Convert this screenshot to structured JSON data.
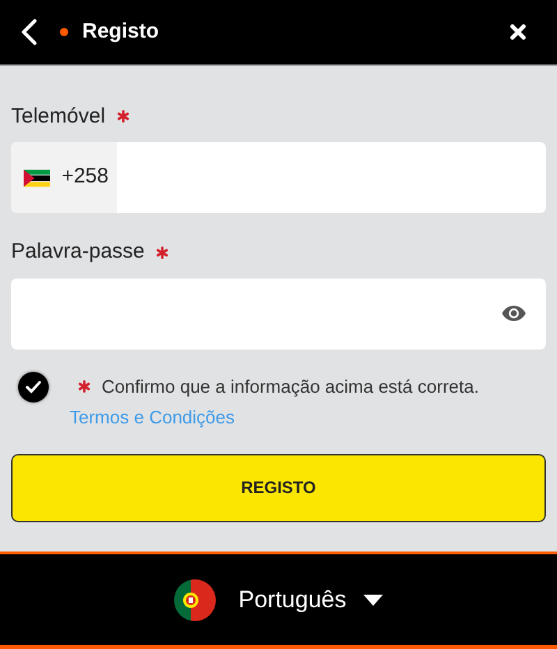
{
  "header": {
    "title": "Registo"
  },
  "fields": [
    {
      "kind": "phone",
      "label": "Telemóvel",
      "required": true,
      "prefix": "+258"
    },
    {
      "kind": "password",
      "label": "Palavra-passe",
      "required": true
    }
  ],
  "consent": {
    "checked": true,
    "required": true,
    "text": "Confirmo que a informação acima está correta.",
    "link": "Termos e Condições"
  },
  "submit": "REGISTO",
  "language": {
    "label": "Português"
  }
}
